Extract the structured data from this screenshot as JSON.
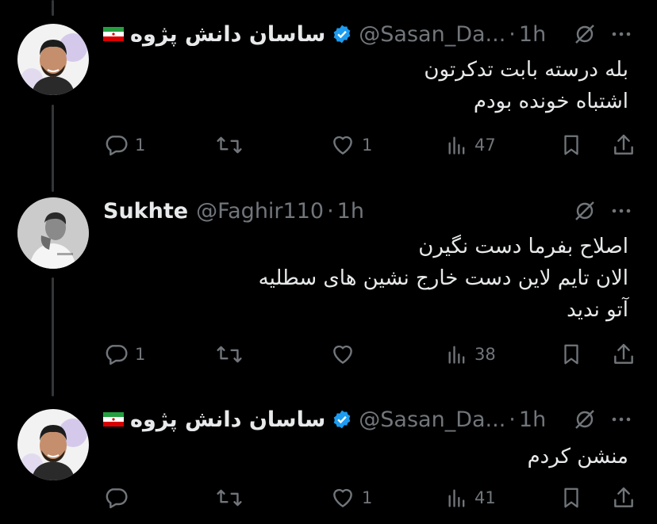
{
  "tweets": [
    {
      "name": "ساسان دانش پژوه",
      "handle": "@Sasan_Da...",
      "dot": "·",
      "time": "1h",
      "verified": true,
      "flag": "iran-flag",
      "avatar": "avatar-sasan",
      "lines": [
        "بله درسته بابت تدکرتون",
        "اشتباه خونده بودم"
      ],
      "replies": "1",
      "retweets": "",
      "likes": "1",
      "views": "47"
    },
    {
      "name": "Sukhte",
      "handle": "@Faghir110",
      "dot": "·",
      "time": "1h",
      "verified": false,
      "avatar": "avatar-sukhte",
      "lines": [
        "اصلاح بفرما دست نگیرن",
        "الان تایم لاین دست خارج نشین های سطلیه",
        "آتو ندید"
      ],
      "replies": "1",
      "retweets": "",
      "likes": "",
      "views": "38"
    },
    {
      "name": "ساسان دانش پژوه",
      "handle": "@Sasan_Da...",
      "dot": "·",
      "time": "1h",
      "verified": true,
      "flag": "iran-flag",
      "avatar": "avatar-sasan",
      "lines": [
        "منشن کردم"
      ],
      "replies": "",
      "retweets": "",
      "likes": "1",
      "views": "41"
    }
  ],
  "colors": {
    "background": "#000000",
    "text": "#e7e9ea",
    "muted": "#71767b",
    "verified": "#1d9bf0",
    "thread_line": "#333639"
  }
}
